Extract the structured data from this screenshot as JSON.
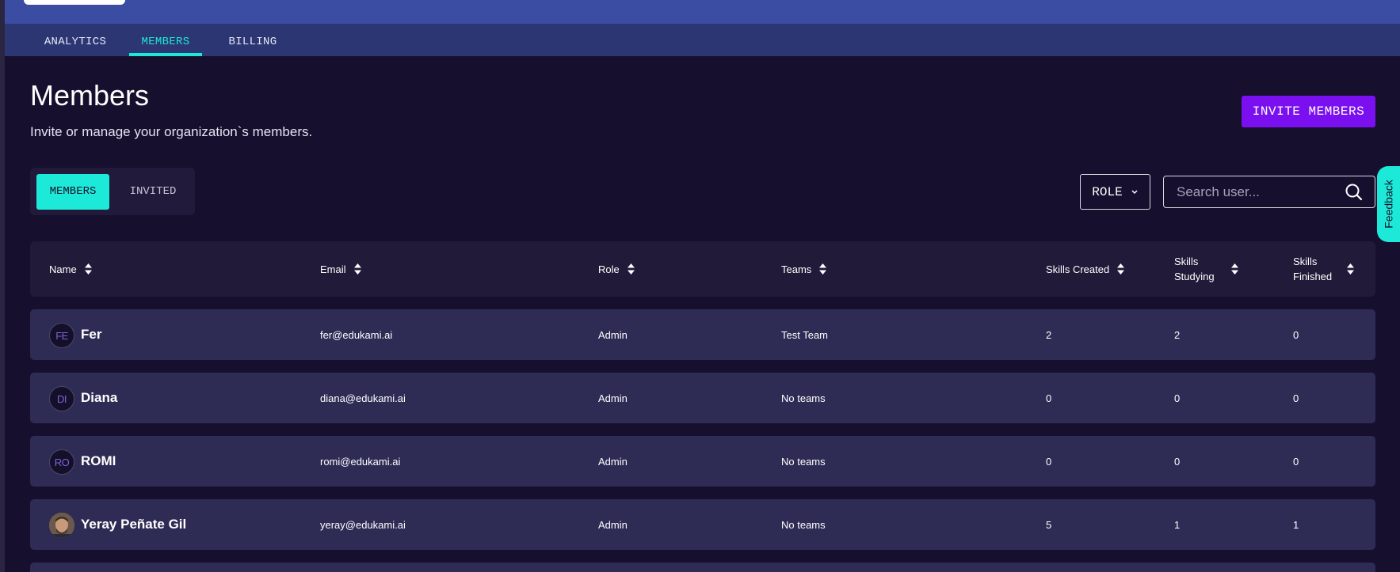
{
  "nav": {
    "tabs": [
      {
        "label": "ANALYTICS",
        "active": false
      },
      {
        "label": "MEMBERS",
        "active": true
      },
      {
        "label": "BILLING",
        "active": false
      }
    ]
  },
  "header": {
    "title": "Members",
    "subtitle": "Invite or manage your organization`s members.",
    "invite_label": "INVITE MEMBERS"
  },
  "segment": {
    "members_label": "MEMBERS",
    "invited_label": "INVITED"
  },
  "filters": {
    "role_label": "ROLE",
    "search_placeholder": "Search user..."
  },
  "feedback_label": "Feedback",
  "table": {
    "columns": [
      "Name",
      "Email",
      "Role",
      "Teams",
      "Skills Created",
      "Skills Studying",
      "Skills Finished"
    ],
    "rows": [
      {
        "initials": "FE",
        "name": "Fer",
        "email": "fer@edukami.ai",
        "role": "Admin",
        "teams": "Test Team",
        "created": "2",
        "studying": "2",
        "finished": "0"
      },
      {
        "initials": "DI",
        "name": "Diana",
        "email": "diana@edukami.ai",
        "role": "Admin",
        "teams": "No teams",
        "created": "0",
        "studying": "0",
        "finished": "0"
      },
      {
        "initials": "RO",
        "name": "ROMI",
        "email": "romi@edukami.ai",
        "role": "Admin",
        "teams": "No teams",
        "created": "0",
        "studying": "0",
        "finished": "0"
      },
      {
        "initials": "",
        "name": "Yeray Peñate Gil",
        "email": "yeray@edukami.ai",
        "role": "Admin",
        "teams": "No teams",
        "created": "5",
        "studying": "1",
        "finished": "1"
      }
    ]
  },
  "colors": {
    "accent": "#1de9d8",
    "primary": "#7a10f0",
    "background": "#170f2e",
    "row": "#2e2c55",
    "topbar": "#3b4da3"
  }
}
